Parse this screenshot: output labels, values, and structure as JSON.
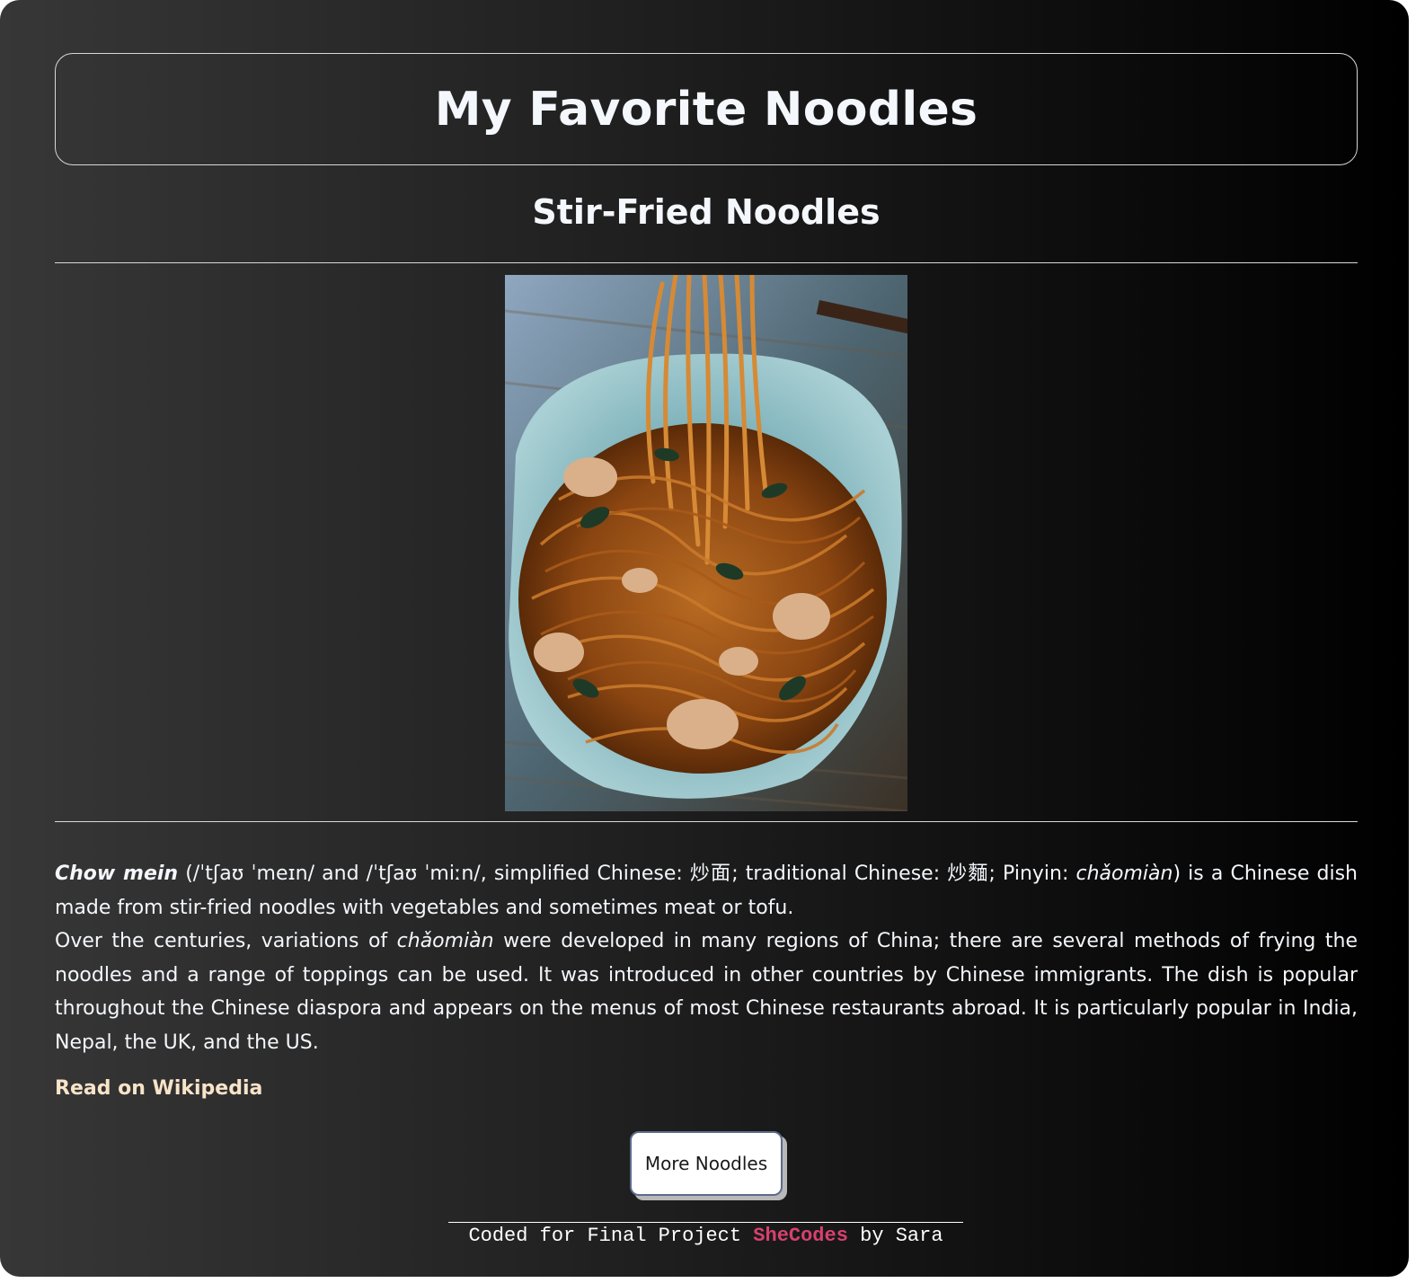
{
  "header": {
    "title": "My Favorite Noodles"
  },
  "section": {
    "title": "Stir-Fried Noodles"
  },
  "description": {
    "term": "Chow mein",
    "p1_a": " (/ˈtʃaʊ ˈmeɪn/ and /ˈtʃaʊ ˈmiːn/, simplified Chinese: 炒面; traditional Chinese: 炒麵; Pinyin: ",
    "pinyin": "chǎomiàn",
    "p1_b": ") is a Chinese dish made from stir-fried noodles with vegetables and sometimes meat or tofu.",
    "p2_a": "Over the centuries, variations of ",
    "p2_pinyin": "chǎomiàn",
    "p2_b": " were developed in many regions of China; there are several methods of frying the noodles and a range of toppings can be used. It was introduced in other countries by Chinese immigrants. The dish is popular throughout the Chinese diaspora and appears on the menus of most Chinese restaurants abroad. It is particularly popular in India, Nepal, the UK, and the US."
  },
  "links": {
    "wiki_label": "Read on Wikipedia"
  },
  "buttons": {
    "more_label": "More Noodles"
  },
  "footer": {
    "prefix": "Coded for Final Project ",
    "brand": "SheCodes",
    "suffix": " by Sara"
  },
  "colors": {
    "link": "#f7e4c9",
    "brand": "#d8416d",
    "text": "#f4f7fb"
  }
}
